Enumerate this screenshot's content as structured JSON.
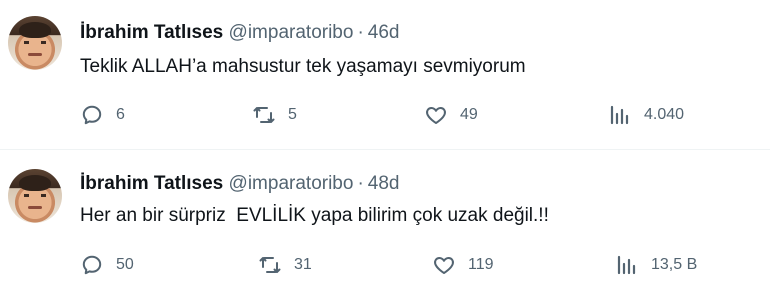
{
  "tweets": [
    {
      "name": "İbrahim Tatlıses",
      "handle": "@imparatoribo",
      "separator": "·",
      "time": "46d",
      "text": "Teklik ALLAH’a mahsustur tek yaşamayı sevmiyorum",
      "replies": "6",
      "retweets": "5",
      "likes": "49",
      "views": "4.040"
    },
    {
      "name": "İbrahim Tatlıses",
      "handle": "@imparatoribo",
      "separator": "·",
      "time": "48d",
      "text": "Her an bir sürpriz  EVLİLİK yapa bilirim çok uzak değil.!!",
      "replies": "50",
      "retweets": "31",
      "likes": "119",
      "views": "13,5 B"
    }
  ],
  "icons": {
    "reply": "reply-icon",
    "retweet": "retweet-icon",
    "like": "heart-icon",
    "views": "views-icon"
  },
  "colors": {
    "text": "#0f1419",
    "secondary": "#536471",
    "divider": "#eff3f4"
  }
}
